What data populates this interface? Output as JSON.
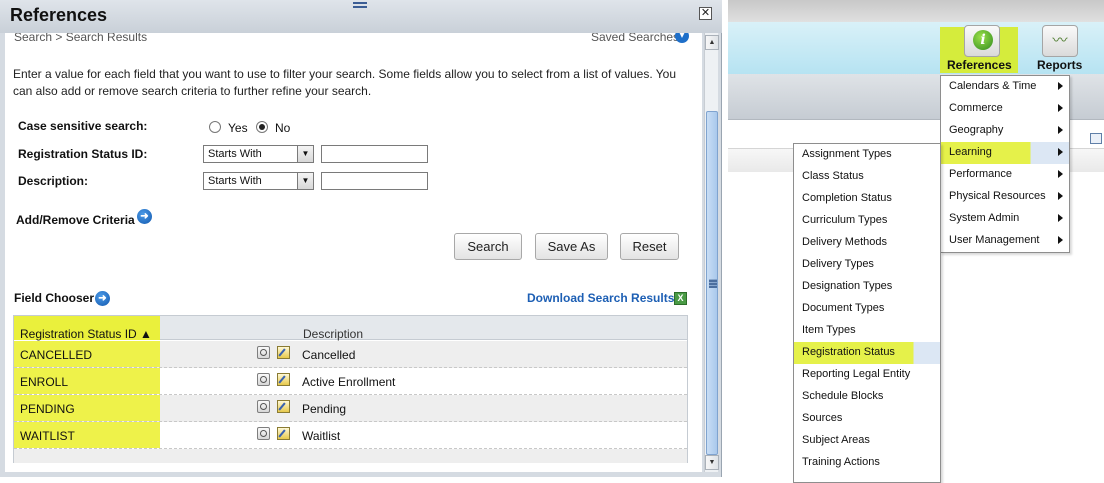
{
  "dialog": {
    "title": "References",
    "close_glyph": "✕",
    "breadcrumb": "Search > Search Results",
    "saved_searches": "Saved Searches",
    "instructions": "Enter a value for each field that you want to use to filter your search. Some fields allow you to select from a list of values. You can also add or remove search criteria to further refine your search.",
    "case_sensitive": {
      "label": "Case sensitive search:",
      "options": [
        "Yes",
        "No"
      ],
      "selected": "No"
    },
    "criteria": [
      {
        "label": "Registration Status ID:",
        "operator": "Starts With",
        "value": ""
      },
      {
        "label": "Description:",
        "operator": "Starts With",
        "value": ""
      }
    ],
    "add_remove_label": "Add/Remove Criteria",
    "buttons": {
      "search": "Search",
      "save_as": "Save As",
      "reset": "Reset"
    },
    "field_chooser_label": "Field Chooser",
    "download_label": "Download Search Results",
    "grid": {
      "columns": [
        "Registration Status ID ▲",
        "Description"
      ],
      "rows": [
        {
          "id": "CANCELLED",
          "description": "Cancelled"
        },
        {
          "id": "ENROLL",
          "description": "Active Enrollment"
        },
        {
          "id": "PENDING",
          "description": "Pending"
        },
        {
          "id": "WAITLIST",
          "description": "Waitlist"
        }
      ]
    }
  },
  "app": {
    "nav": [
      {
        "label": "References",
        "icon": "info-icon",
        "active": true
      },
      {
        "label": "Reports",
        "icon": "chart-icon",
        "active": false
      }
    ],
    "references_menu": [
      "Calendars & Time",
      "Commerce",
      "Geography",
      "Learning",
      "Performance",
      "Physical Resources",
      "System Admin",
      "User Management"
    ],
    "references_menu_active": "Learning",
    "learning_menu": [
      "Assignment Types",
      "Class Status",
      "Completion Status",
      "Curriculum Types",
      "Delivery Methods",
      "Delivery Types",
      "Designation Types",
      "Document Types",
      "Item Types",
      "Registration Status",
      "Reporting Legal Entity",
      "Schedule Blocks",
      "Sources",
      "Subject Areas",
      "Training Actions"
    ],
    "learning_menu_active": "Registration Status"
  },
  "colors": {
    "highlight": "#eef24a",
    "link": "#1d5fb4",
    "header": "#b6e3f2"
  }
}
